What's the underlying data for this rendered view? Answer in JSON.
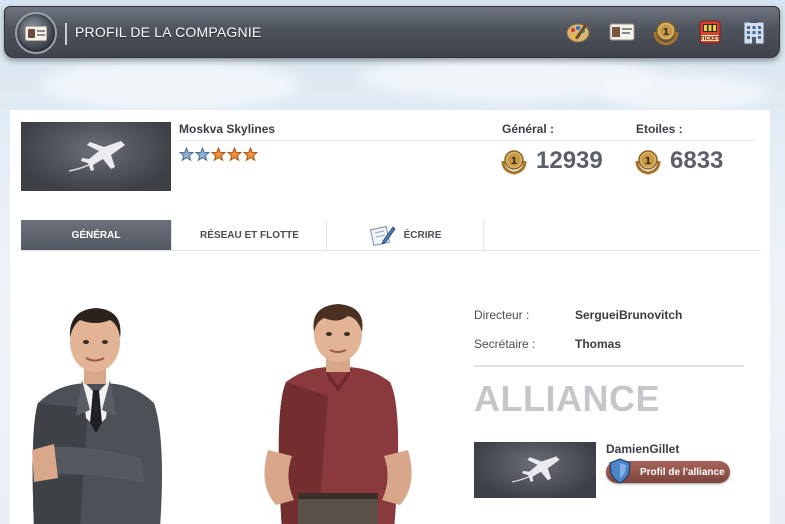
{
  "header": {
    "title": "PROFIL DE LA COMPAGNIE",
    "icons": [
      "palette-icon",
      "id-card-icon",
      "coin-medal-icon",
      "ticket-icon",
      "building-icon"
    ],
    "ticket_text": "TICKET"
  },
  "company": {
    "name": "Moskva Skylines",
    "rating": {
      "filled_blue": 2,
      "filled_orange": 3,
      "max": 5
    },
    "general_label": "Général :",
    "general_value": "12939",
    "stars_label": "Etoiles :",
    "stars_value": "6833",
    "medal_number": "1"
  },
  "tabs": [
    {
      "label": "GÉNÉRAL",
      "active": true
    },
    {
      "label": "RÉSEAU ET FLOTTE",
      "active": false
    },
    {
      "label": "ÉCRIRE",
      "active": false
    }
  ],
  "staff": {
    "director_label": "Directeur :",
    "director_value": "SergueiBrunovitch",
    "secretary_label": "Secrétaire :",
    "secretary_value": "Thomas"
  },
  "alliance": {
    "title": "ALLIANCE",
    "member": "DamienGillet",
    "profile_button": "Profil de l'alliance"
  },
  "colors": {
    "topbar": "#4d525c",
    "active_tab": "#5e636e",
    "alliance_button": "#8e5248",
    "star_blue": "#7a9cc0",
    "star_orange": "#e07b2a"
  }
}
